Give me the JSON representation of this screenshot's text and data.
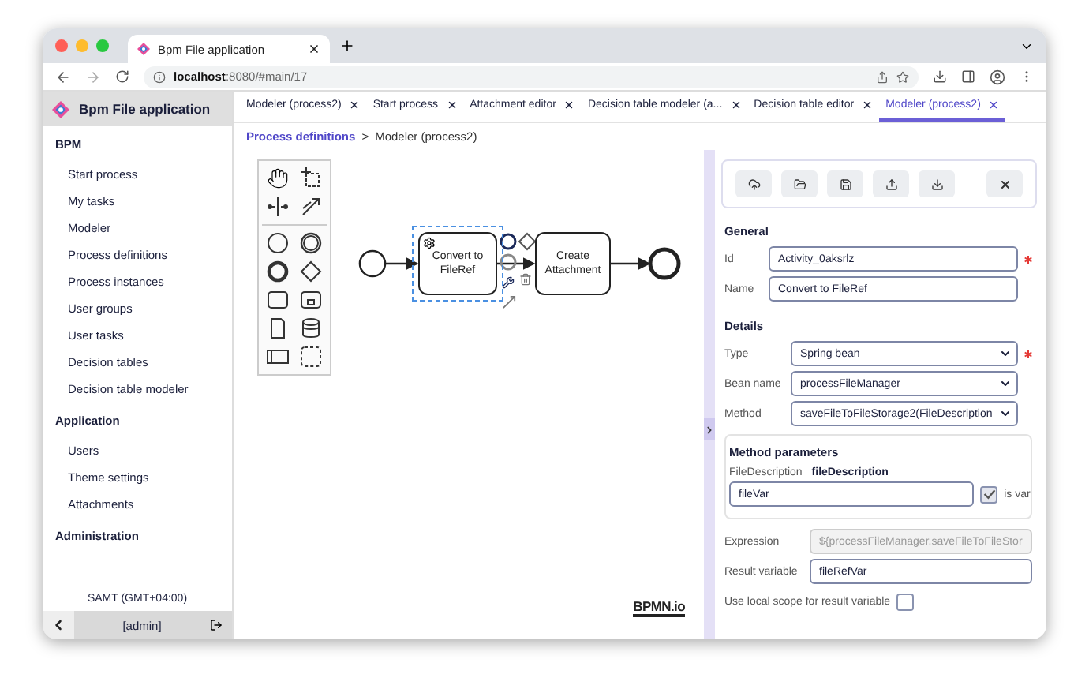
{
  "browser": {
    "tab_title": "Bpm File application",
    "url": "**localhost**:8080/#main/17"
  },
  "sidebar": {
    "title": "Bpm File application",
    "groups": [
      {
        "title": "BPM",
        "items": [
          "Start process",
          "My tasks",
          "Modeler",
          "Process definitions",
          "Process instances",
          "User groups",
          "User tasks",
          "Decision tables",
          "Decision table modeler"
        ]
      },
      {
        "title": "Application",
        "items": [
          "Users",
          "Theme settings",
          "Attachments"
        ]
      },
      {
        "title": "Administration"
      }
    ],
    "timezone": "SAMT (GMT+04:00)",
    "user": "[admin]"
  },
  "tabs": [
    {
      "label": "Modeler (process2)",
      "selected": false
    },
    {
      "label": "Start process",
      "selected": false
    },
    {
      "label": "Attachment editor",
      "selected": false
    },
    {
      "label": "Decision table modeler (a...",
      "selected": false
    },
    {
      "label": "Decision table editor",
      "selected": false
    },
    {
      "label": "Modeler (process2)",
      "selected": true
    }
  ],
  "breadcrumb": {
    "link": "Process definitions",
    "separator": ">",
    "current": "Modeler (process2)"
  },
  "diagram": {
    "tasks": [
      {
        "label": "Convert to FileRef",
        "selected": true
      },
      {
        "label": "Create Attachment",
        "selected": false
      }
    ],
    "logo": "BPMN.io"
  },
  "properties": {
    "general": {
      "title": "General",
      "fields": [
        {
          "label": "Id",
          "value": "Activity_0aksrlz",
          "required": true
        },
        {
          "label": "Name",
          "value": "Convert to FileRef",
          "required": false
        }
      ]
    },
    "details": {
      "title": "Details",
      "fields": [
        {
          "label": "Type",
          "value": "Spring bean",
          "required": true
        },
        {
          "label": "Bean name",
          "value": "processFileManager",
          "required": false
        },
        {
          "label": "Method",
          "value": "saveFileToFileStorage2(FileDescription",
          "required": false
        }
      ]
    },
    "method_parameters": {
      "title": "Method parameters",
      "type": "FileDescription",
      "name": "fileDescription",
      "value": "fileVar",
      "is_var": {
        "label": "is var",
        "checked": true
      }
    },
    "expression": {
      "label": "Expression",
      "value": "${processFileManager.saveFileToFileStor",
      "disabled": true
    },
    "result_variable": {
      "label": "Result variable",
      "value": "fileRefVar"
    },
    "local_scope": {
      "label": "Use local scope for result variable",
      "checked": false
    }
  }
}
